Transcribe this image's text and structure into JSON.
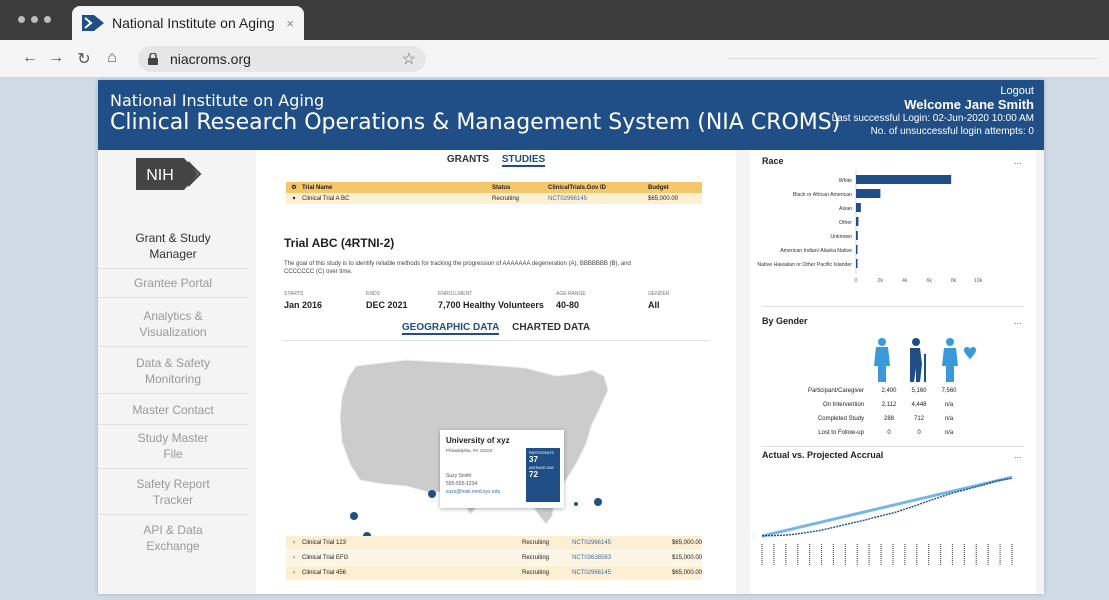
{
  "browser": {
    "tab_title": "National Institute on Aging",
    "url": "niacroms.org",
    "close_glyph": "×",
    "back_glyph": "←",
    "forward_glyph": "→",
    "reload_glyph": "↻",
    "home_glyph": "⌂",
    "star_glyph": "☆",
    "icons": [
      "back-icon",
      "forward-icon",
      "reload-icon",
      "home-icon",
      "lock-icon",
      "star-icon"
    ]
  },
  "header": {
    "org": "National Institute on Aging",
    "system": "Clinical Research Operations & Management System (NIA CROMS)",
    "logout": "Logout",
    "welcome": "Welcome Jane Smith",
    "last_login": "Last successful Login:  02-Jun-2020 10:00 AM",
    "attempts": "No. of unsuccessful login attempts: 0"
  },
  "sidebar": {
    "logo_text": "NIH",
    "items": [
      {
        "line1": "Grant & Study",
        "line2": "Manager"
      },
      {
        "line1": "Grantee Portal",
        "line2": ""
      },
      {
        "line1": "Analytics &",
        "line2": "Visualization"
      },
      {
        "line1": "Data & Safety",
        "line2": "Monitoring"
      },
      {
        "line1": "Master Contact",
        "line2": ""
      },
      {
        "line1": "Study Master",
        "line2": "File"
      },
      {
        "line1": "Safety Report",
        "line2": "Tracker"
      },
      {
        "line1": "API & Data",
        "line2": "Exchange"
      }
    ]
  },
  "center": {
    "tabs": [
      "GRANTS",
      "STUDIES"
    ],
    "table": {
      "headers": [
        "Trial Name",
        "Status",
        "ClinicalTrials.Gov ID",
        "Budget"
      ],
      "selected": {
        "name": "Clinical Trial A BC",
        "status": "Recruiting",
        "id": "NCT02966145",
        "budget": "$65,000.00"
      }
    },
    "trial": {
      "title": "Trial ABC (4RTNI-2)",
      "description": "The goal of this study is to identify reliable methods for tracking the progression of AAAAAAA degeneration (A), BBBBBBB (B), and CCCCCCC (C) over time.",
      "stats": [
        {
          "label": "STARTS",
          "value": "Jan 2016"
        },
        {
          "label": "ENDS",
          "value": "DEC 2021"
        },
        {
          "label": "ENROLLMENT",
          "value": "7,700 Healthy Volunteers"
        },
        {
          "label": "AGE RANGE",
          "value": "40-80"
        },
        {
          "label": "GENDER",
          "value": "All"
        }
      ]
    },
    "subtabs": [
      "GEOGRAPHIC DATA",
      "CHARTED DATA"
    ],
    "map_card": {
      "name": "University of xyz",
      "location": "Philadelphia, PA 19104",
      "contact_name": "Suzy Smith",
      "phone": "555-555-1234",
      "email": "suzs@mail.med.xyz.edu",
      "participants_label": "PARTICIPANTS",
      "participants": "37",
      "age_label": "AVERAGE AGE",
      "age": "72"
    },
    "rows": [
      {
        "name": "Clinical Trial 123",
        "status": "Recruiting",
        "id": "NCT02966145",
        "budget": "$65,000.00"
      },
      {
        "name": "Clinical Trial EFG",
        "status": "Recruiting",
        "id": "NCT03638583",
        "budget": "$15,000.00"
      },
      {
        "name": "Clinical Trial 456",
        "status": "Recruiting",
        "id": "NCT02966145",
        "budget": "$65,000.00"
      }
    ]
  },
  "right": {
    "race": {
      "title": "Race",
      "menu": "...",
      "categories": [
        "White",
        "Black or African American",
        "Asian",
        "Other",
        "Unknown",
        "American Indian/ Alaska Native",
        "Native Hawaiian or Other Pacific Islander"
      ],
      "values": [
        7800,
        2000,
        400,
        200,
        150,
        100,
        50
      ],
      "ticks": [
        "0",
        "2k",
        "4k",
        "6k",
        "8k",
        "10k"
      ],
      "xmax": 10000,
      "bar_color": "#1f4f86"
    },
    "gender": {
      "title": "By Gender",
      "menu": "...",
      "rows": [
        {
          "label": "Participant/Caregiver",
          "values": [
            "2,400",
            "5,160",
            "7,560"
          ]
        },
        {
          "label": "On Intervention",
          "values": [
            "2,112",
            "4,448",
            "n/a"
          ]
        },
        {
          "label": "Completed Study",
          "values": [
            "288",
            "712",
            "n/a"
          ]
        },
        {
          "label": "Lost to Follow-up",
          "values": [
            "0",
            "0",
            "n/a"
          ]
        }
      ],
      "icon_color": "#1f4f86",
      "icon_color2": "#3a9ad9"
    },
    "accrual": {
      "title": "Actual vs. Projected Accrual",
      "menu": "..."
    }
  },
  "chart_data": [
    {
      "type": "bar",
      "title": "Race",
      "categories": [
        "White",
        "Black or African American",
        "Asian",
        "Other",
        "Unknown",
        "American Indian/ Alaska Native",
        "Native Hawaiian or Other Pacific Islander"
      ],
      "values": [
        7800,
        2000,
        400,
        200,
        150,
        100,
        50
      ],
      "xlim": [
        0,
        10000
      ]
    },
    {
      "type": "line",
      "title": "Actual vs. Projected Accrual",
      "series": [
        {
          "values": [
            20,
            60,
            180,
            450,
            760,
            1210,
            1678,
            2123,
            2657,
            3120,
            3762,
            4458,
            5121,
            5754,
            6271,
            6788,
            7379,
            7700
          ]
        }
      ]
    }
  ]
}
